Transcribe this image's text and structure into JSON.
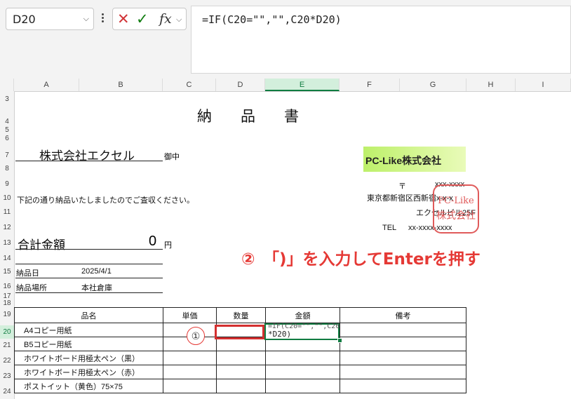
{
  "formula_bar": {
    "name_box": "D20",
    "cancel_icon": "✕",
    "enter_icon": "✓",
    "fx_label": "fx",
    "formula": "=IF(C20=\"\",\"\",C20*D20)"
  },
  "columns": [
    "A",
    "B",
    "C",
    "D",
    "E",
    "F",
    "G",
    "H",
    "I"
  ],
  "rows": [
    "3",
    "4",
    "5",
    "6",
    "7",
    "8",
    "9",
    "10",
    "11",
    "12",
    "13",
    "14",
    "15",
    "16",
    "17",
    "18",
    "19",
    "20",
    "21",
    "22",
    "23",
    "24"
  ],
  "sheet": {
    "title": "納　品　書",
    "customer": "株式会社エクセル",
    "honorific": "御中",
    "intro": "下記の通り納品いたしましたのでご査収ください。",
    "total_label": "合計金額",
    "total_value": "0",
    "total_unit": "円",
    "delivery_date_label": "納品日",
    "delivery_date": "2025/4/1",
    "delivery_place_label": "納品場所",
    "delivery_place": "本社倉庫",
    "logo_text": "PC-Like株式会社",
    "postal_mark": "〒",
    "postal_code": "xxx-xxxx",
    "address": "東京都新宿区西新宿x-x-x",
    "building": "エクセルビル25F",
    "tel_label": "TEL",
    "tel": "xx-xxxx-xxxx",
    "stamp_line1": "PC-Like",
    "stamp_line2": "株式会社"
  },
  "table": {
    "headers": [
      "品名",
      "単価",
      "数量",
      "金額",
      "備考"
    ],
    "items": [
      "A4コピー用紙",
      "B5コピー用紙",
      "ホワイトボード用極太ペン（黒）",
      "ホワイトボード用極太ペン（赤）",
      "ポストイット（黄色）75×75"
    ]
  },
  "editing_cell": {
    "line1": "=IF(C20=\"\",\"\",C20",
    "line2": "*D20)"
  },
  "annotations": {
    "step1": "①",
    "step2": "②　「)」を入力してEnterを押す"
  }
}
